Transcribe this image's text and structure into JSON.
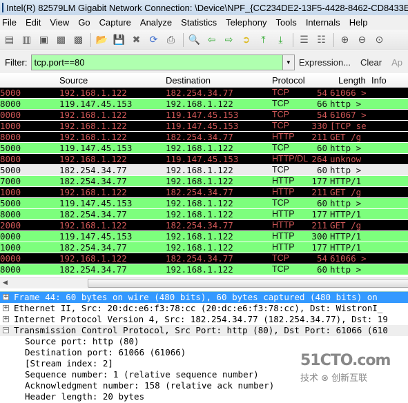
{
  "window": {
    "title": "Intel(R) 82579LM Gigabit Network Connection: \\Device\\NPF_{CC234DE2-13F5-4428-8462-CD8433E"
  },
  "menu": [
    "File",
    "Edit",
    "View",
    "Go",
    "Capture",
    "Analyze",
    "Statistics",
    "Telephony",
    "Tools",
    "Internals",
    "Help"
  ],
  "toolbar": {
    "icons": [
      "interfaces-icon",
      "options-icon",
      "start-icon",
      "stop-icon",
      "restart-icon",
      "open-icon",
      "save-icon",
      "close-icon",
      "reload-icon",
      "print-icon",
      "find-icon",
      "back-icon",
      "forward-icon",
      "goto-icon",
      "first-icon",
      "last-icon",
      "colorize-icon",
      "autoscroll-icon",
      "zoom-in-icon",
      "zoom-out-icon",
      "zoom-normal-icon"
    ]
  },
  "filter": {
    "label": "Filter:",
    "value": "tcp.port==80",
    "expression": "Expression...",
    "clear": "Clear",
    "apply": "Ap"
  },
  "columns": [
    "",
    "Source",
    "Destination",
    "Protocol",
    "Length",
    "Info"
  ],
  "packets": [
    {
      "time": "5000",
      "src": "192.168.1.122",
      "dst": "182.254.34.77",
      "proto": "TCP",
      "len": "54",
      "info": "61066 >",
      "style": "black"
    },
    {
      "time": "8000",
      "src": "119.147.45.153",
      "dst": "192.168.1.122",
      "proto": "TCP",
      "len": "66",
      "info": "http >",
      "style": "green"
    },
    {
      "time": "0000",
      "src": "192.168.1.122",
      "dst": "119.147.45.153",
      "proto": "TCP",
      "len": "54",
      "info": "61067 >",
      "style": "black"
    },
    {
      "time": "1000",
      "src": "192.168.1.122",
      "dst": "119.147.45.153",
      "proto": "TCP",
      "len": "330",
      "info": "[TCP se",
      "style": "black"
    },
    {
      "time": "8000",
      "src": "192.168.1.122",
      "dst": "182.254.34.77",
      "proto": "HTTP",
      "len": "211",
      "info": "GET /g",
      "style": "black"
    },
    {
      "time": "5000",
      "src": "119.147.45.153",
      "dst": "192.168.1.122",
      "proto": "TCP",
      "len": "60",
      "info": "http >",
      "style": "green"
    },
    {
      "time": "8000",
      "src": "192.168.1.122",
      "dst": "119.147.45.153",
      "proto": "HTTP/DL",
      "len": "264",
      "info": "unknow",
      "style": "black"
    },
    {
      "time": "5000",
      "src": "182.254.34.77",
      "dst": "192.168.1.122",
      "proto": "TCP",
      "len": "60",
      "info": "http >",
      "style": "sel"
    },
    {
      "time": "7000",
      "src": "182.254.34.77",
      "dst": "192.168.1.122",
      "proto": "HTTP",
      "len": "177",
      "info": "HTTP/1",
      "style": "green"
    },
    {
      "time": "1000",
      "src": "192.168.1.122",
      "dst": "182.254.34.77",
      "proto": "HTTP",
      "len": "211",
      "info": "GET /g",
      "style": "black"
    },
    {
      "time": "5000",
      "src": "119.147.45.153",
      "dst": "192.168.1.122",
      "proto": "TCP",
      "len": "60",
      "info": "http >",
      "style": "green"
    },
    {
      "time": "8000",
      "src": "182.254.34.77",
      "dst": "192.168.1.122",
      "proto": "HTTP",
      "len": "177",
      "info": "HTTP/1",
      "style": "green"
    },
    {
      "time": "2000",
      "src": "192.168.1.122",
      "dst": "182.254.34.77",
      "proto": "HTTP",
      "len": "211",
      "info": "GET /g",
      "style": "black"
    },
    {
      "time": "0000",
      "src": "119.147.45.153",
      "dst": "192.168.1.122",
      "proto": "HTTP",
      "len": "300",
      "info": "HTTP/1",
      "style": "green"
    },
    {
      "time": "1000",
      "src": "182.254.34.77",
      "dst": "192.168.1.122",
      "proto": "HTTP",
      "len": "177",
      "info": "HTTP/1",
      "style": "green"
    },
    {
      "time": "0000",
      "src": "192.168.1.122",
      "dst": "182.254.34.77",
      "proto": "TCP",
      "len": "54",
      "info": "61066 >",
      "style": "black"
    },
    {
      "time": "8000",
      "src": "182.254.34.77",
      "dst": "192.168.1.122",
      "proto": "TCP",
      "len": "60",
      "info": "http >",
      "style": "green"
    }
  ],
  "details": [
    {
      "text": "Frame 44: 60 bytes on wire (480 bits), 60 bytes captured (480 bits) on",
      "toggle": "+",
      "style": "sel"
    },
    {
      "text": "Ethernet II, Src: 20:dc:e6:f3:78:cc (20:dc:e6:f3:78:cc), Dst: WistronI_",
      "toggle": "+",
      "style": ""
    },
    {
      "text": "Internet Protocol Version 4, Src: 182.254.34.77 (182.254.34.77), Dst: 19",
      "toggle": "+",
      "style": ""
    },
    {
      "text": "Transmission Control Protocol, Src Port: http (80), Dst Port: 61066 (610",
      "toggle": "−",
      "style": "exp"
    },
    {
      "text": "Source port: http (80)",
      "toggle": "",
      "style": "sub"
    },
    {
      "text": "Destination port: 61066 (61066)",
      "toggle": "",
      "style": "sub"
    },
    {
      "text": "[Stream index: 2]",
      "toggle": "",
      "style": "sub"
    },
    {
      "text": "Sequence number: 1    (relative sequence number)",
      "toggle": "",
      "style": "sub"
    },
    {
      "text": "Acknowledgment number: 158    (relative ack number)",
      "toggle": "",
      "style": "sub"
    },
    {
      "text": "Header length: 20 bytes",
      "toggle": "",
      "style": "sub"
    }
  ],
  "watermark": {
    "line1": "51CTO.com",
    "line2": "技术 创新互联"
  },
  "colors": {
    "black_row_bg": "#000000",
    "black_row_fg": "#d05858",
    "green_row_bg": "#7dff7d",
    "filter_bg": "#afffaf",
    "selected_detail": "#3399ff"
  }
}
